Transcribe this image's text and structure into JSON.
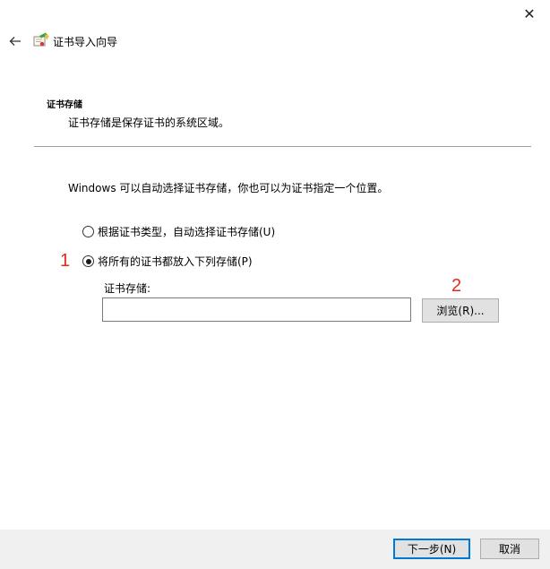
{
  "window": {
    "close_glyph": "✕",
    "back_glyph": "←",
    "title": "证书导入向导"
  },
  "header": {
    "section_title": "证书存储",
    "section_desc": "证书存储是保存证书的系统区域。"
  },
  "main": {
    "intro": "Windows 可以自动选择证书存储，你也可以为证书指定一个位置。",
    "options": [
      {
        "label": "根据证书类型，自动选择证书存储(U)",
        "checked": false
      },
      {
        "label": "将所有的证书都放入下列存储(P)",
        "checked": true
      }
    ],
    "store_label": "证书存储:",
    "store_value": "",
    "browse_label": "浏览(R)..."
  },
  "annotations": {
    "one": "1",
    "two": "2",
    "color": "#e8291c"
  },
  "footer": {
    "next_label": "下一步(N)",
    "cancel_label": "取消"
  },
  "colors": {
    "accent": "#0078d7",
    "footer_bg": "#f0f0f0"
  },
  "icons": [
    "close-icon",
    "back-arrow-icon",
    "certificate-wizard-icon"
  ]
}
